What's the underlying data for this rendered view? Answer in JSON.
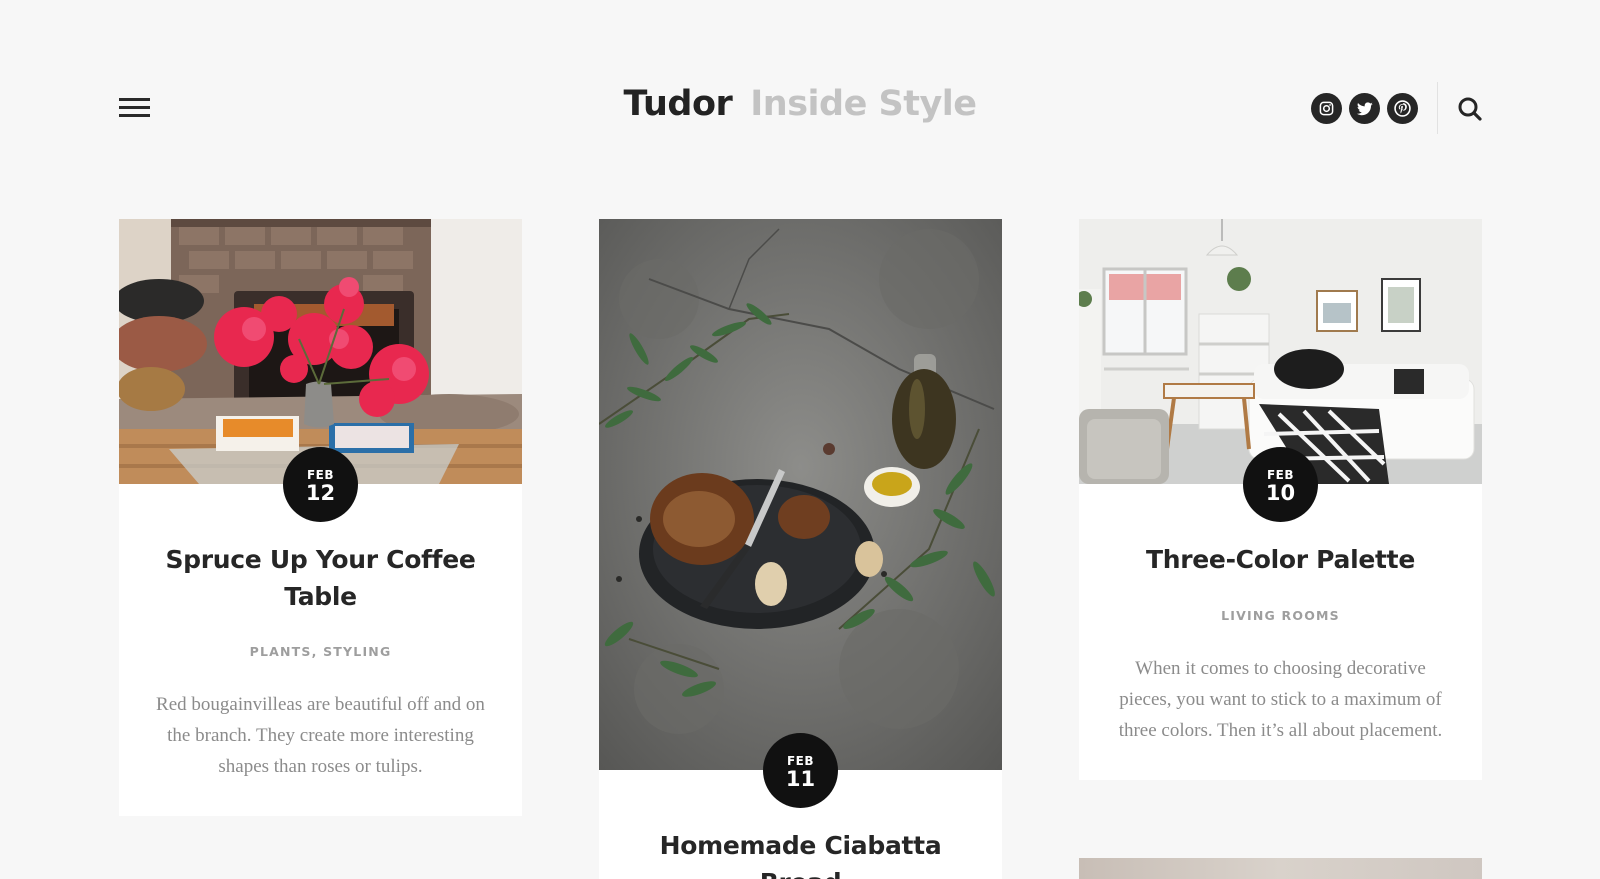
{
  "site": {
    "title_main": "Tudor",
    "title_sub": "Inside Style"
  },
  "header": {
    "social": [
      {
        "name": "instagram-icon"
      },
      {
        "name": "twitter-icon"
      },
      {
        "name": "pinterest-icon"
      }
    ],
    "icons": [
      "hamburger-menu-icon",
      "search-icon"
    ]
  },
  "colors": {
    "background": "#f7f7f7",
    "text_dark": "#262626",
    "logo_sub": "#c3c3c3",
    "meta_gray": "#9e9e9e",
    "excerpt_gray": "#8b8b8b",
    "badge_bg": "#111111"
  },
  "posts": [
    {
      "month": "FEB",
      "day": "12",
      "title": "Spruce Up Your Coffee Table",
      "categories": [
        "PLANTS",
        "STYLING"
      ],
      "category_sep": ",",
      "excerpt": "Red bougainvilleas are beautiful off and on the branch. They create more interesting shapes than roses or tulips.",
      "image": "fireplace with pink bougainvillea on coffee table"
    },
    {
      "month": "FEB",
      "day": "11",
      "title": "Homemade Ciabatta Bread",
      "image": "bread with olive oil and olive branches on concrete"
    },
    {
      "month": "FEB",
      "day": "10",
      "title": "Three-Color Palette",
      "categories": [
        "LIVING ROOMS"
      ],
      "excerpt": "When it comes to choosing decorative pieces, you want to stick to a maximum of three colors. Then it’s all about placement.",
      "image": "white living room with plaid blanket"
    }
  ]
}
